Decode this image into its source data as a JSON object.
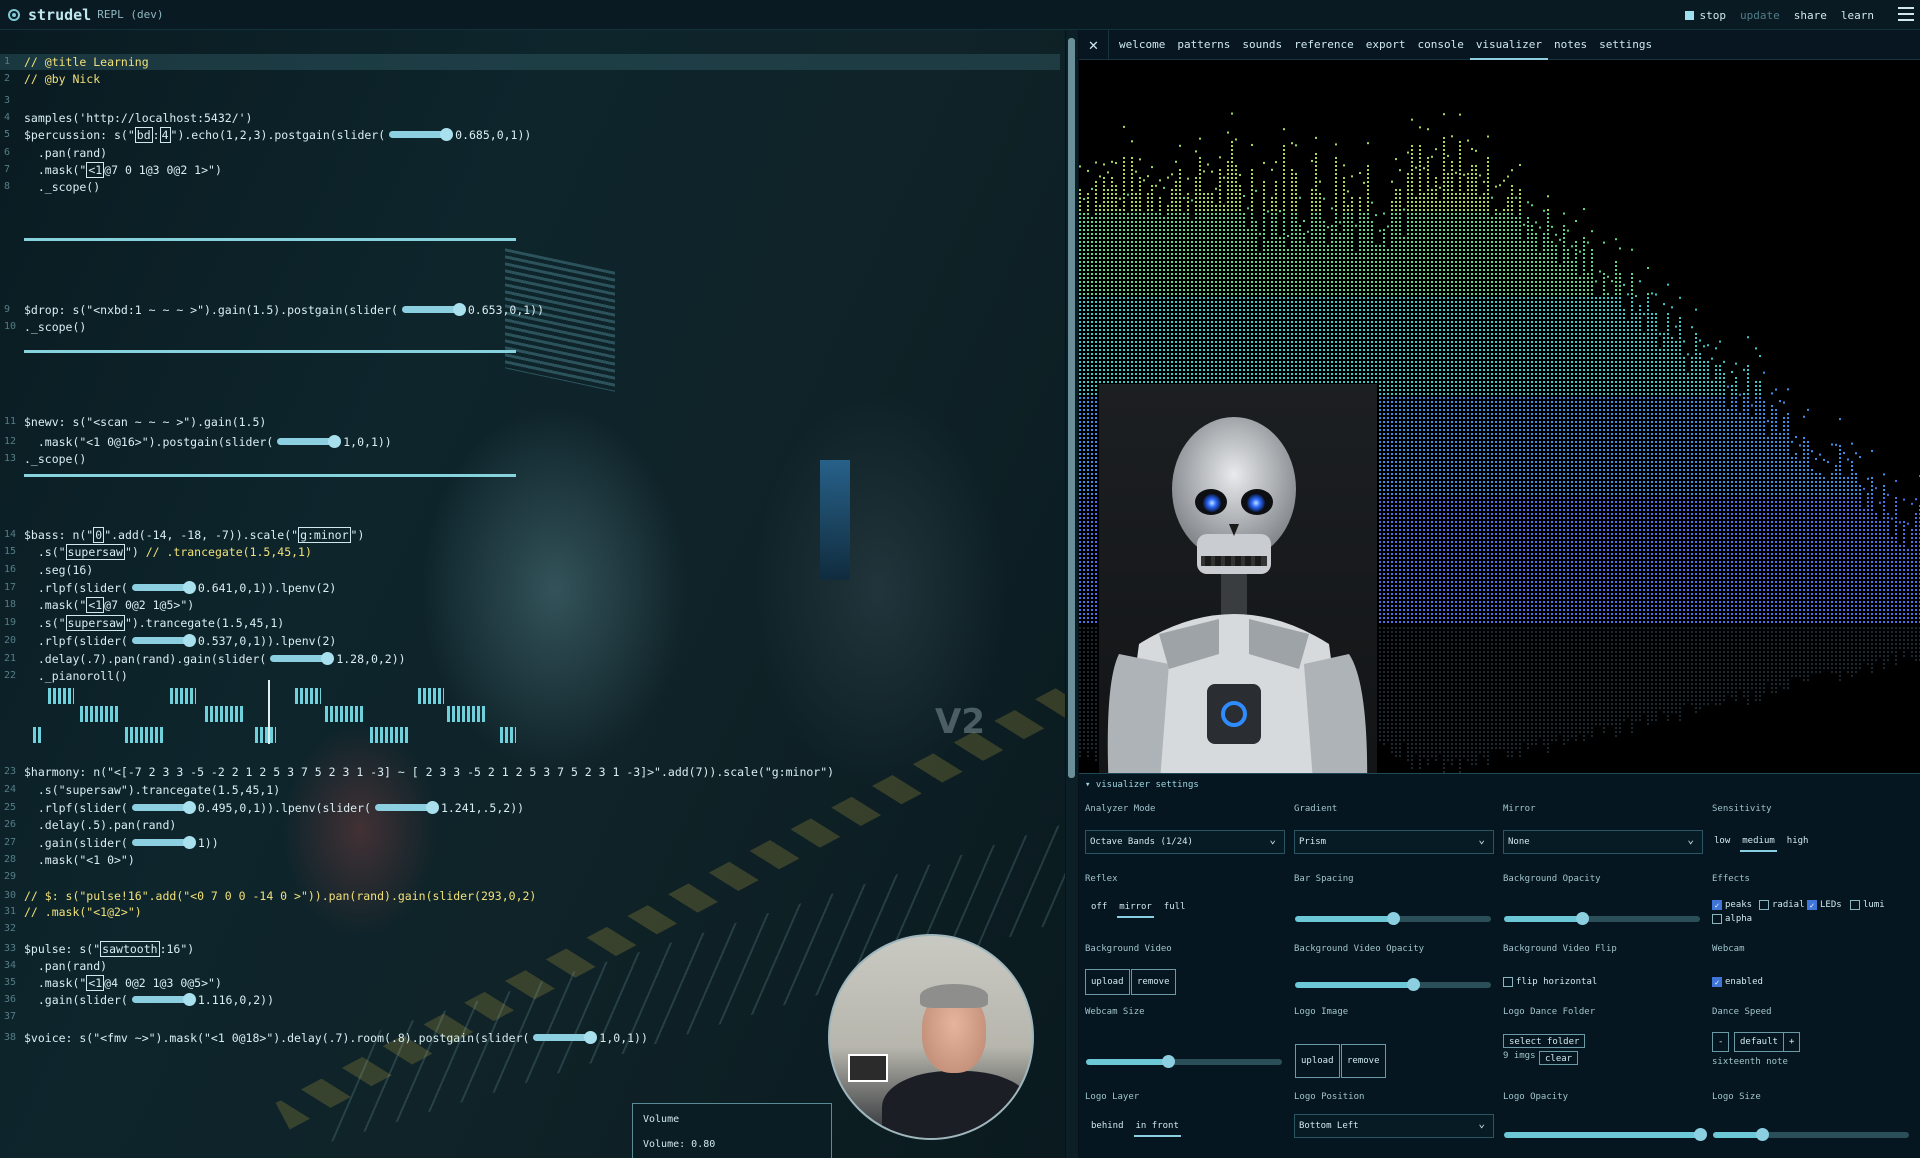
{
  "app": {
    "name": "strudel",
    "sub": "REPL (dev)",
    "actions": {
      "stop": "stop",
      "update": "update",
      "share": "share",
      "learn": "learn"
    }
  },
  "code_lines": [
    {
      "n": "1",
      "html": "<span class=\"c\">// @title Learning</span>",
      "active": true
    },
    {
      "n": "2",
      "html": "<span class=\"c\">// @by Nick</span>"
    },
    {
      "n": "3",
      "html": ""
    },
    {
      "n": "4",
      "html": "samples('http://localhost:5432/')"
    },
    {
      "n": "5",
      "html": "$percussion: s(\"<span class=\"mk\">bd</span>:<span class=\"mk\">4</span>\").echo(1,2,3).postgain(slider(<span class=\"sl\"></span>0.685,0,1))"
    },
    {
      "n": "6",
      "html": "  .pan(rand)"
    },
    {
      "n": "7",
      "html": "  .mask(\"<span class=\"mk\">&lt;1</span>@7 0 1@3 0@2 1&gt;\")"
    },
    {
      "n": "8",
      "html": "  ._scope()"
    },
    {
      "n": "9",
      "html": "$drop: s(\"&lt;nxbd:1 ~ ~ ~ &gt;\").gain(1.5).postgain(slider(<span class=\"sl\"></span>0.653,0,1))"
    },
    {
      "n": "10",
      "html": "._scope()"
    },
    {
      "n": "11",
      "html": "$newv: s(\"&lt;scan ~ ~ ~ &gt;\").gain(1.5)"
    },
    {
      "n": "12",
      "html": "  .mask(\"&lt;1 0@16&gt;\").postgain(slider(<span class=\"sl\"></span>1,0,1))"
    },
    {
      "n": "13",
      "html": "._scope()"
    },
    {
      "n": "14",
      "html": "$bass: n(\"<span class=\"mk\">0</span>\".add(-14, -18, -7)).scale(\"<span class=\"mk\">g:minor</span>\")"
    },
    {
      "n": "15",
      "html": "  .s(\"<span class=\"mk\">supersaw</span>\") <span class=\"c\">// .trancegate(1.5,45,1)</span>"
    },
    {
      "n": "16",
      "html": "  .seg(16)"
    },
    {
      "n": "17",
      "html": "  .rlpf(slider(<span class=\"sl\"></span>0.641,0,1)).lpenv(2)"
    },
    {
      "n": "18",
      "html": "  .mask(\"<span class=\"mk\">&lt;1</span>@7 0@2 1@5&gt;\")"
    },
    {
      "n": "19",
      "html": "  .s(\"<span class=\"mk\">supersaw</span>\").trancegate(1.5,45,1)"
    },
    {
      "n": "20",
      "html": "  .rlpf(slider(<span class=\"sl\"></span>0.537,0,1)).lpenv(2)"
    },
    {
      "n": "21",
      "html": "  .delay(.7).pan(rand).gain(slider(<span class=\"sl\"></span>1.28,0,2))"
    },
    {
      "n": "22",
      "html": "  ._pianoroll()"
    },
    {
      "n": "23",
      "html": "$harmony: n(\"&lt;[-7 2 3 3 -5 -2 2 1 2 5 3 7 5 2 3 1 -3] ~ [ 2 3 3 -5 2 1 2 5 3 7 5 2 3 1 -3]&gt;\".add(7)).scale(\"g:minor\")"
    },
    {
      "n": "24",
      "html": "  .s(\"supersaw\").trancegate(1.5,45,1)"
    },
    {
      "n": "25",
      "html": "  .rlpf(slider(<span class=\"sl\"></span>0.495,0,1)).lpenv(slider(<span class=\"sl\"></span>1.241,.5,2))"
    },
    {
      "n": "26",
      "html": "  .delay(.5).pan(rand)"
    },
    {
      "n": "27",
      "html": "  .gain(slider(<span class=\"sl\"></span>1))"
    },
    {
      "n": "28",
      "html": "  .mask(\"&lt;1 0&gt;\")"
    },
    {
      "n": "29",
      "html": ""
    },
    {
      "n": "30",
      "html": "<span class=\"c\">// $: s(\"pulse!16\".add(\"&lt;0 7 0 0 -14 0 &gt;\")).pan(rand).gain(slider(293,0,2)</span>"
    },
    {
      "n": "31",
      "html": "<span class=\"c\">// .mask(\"&lt;1@2&gt;\")</span>"
    },
    {
      "n": "32",
      "html": ""
    },
    {
      "n": "33",
      "html": "$pulse: s(\"<span class=\"mk\">sawtooth</span>:16\")"
    },
    {
      "n": "34",
      "html": "  .pan(rand)"
    },
    {
      "n": "35",
      "html": "  .mask(\"<span class=\"mk\">&lt;1</span>@4 0@2 1@3 0@5&gt;\")"
    },
    {
      "n": "36",
      "html": "  .gain(slider(<span class=\"sl\"></span>1.116,0,2))"
    },
    {
      "n": "37",
      "html": ""
    },
    {
      "n": "38",
      "html": "$voice: s(\"&lt;fmv ~&gt;\").mask(\"&lt;1 0@18&gt;\").delay(.7).room(.8).postgain(slider(<span class=\"sl\"></span>1,0,1))"
    }
  ],
  "volume": {
    "title": "Volume",
    "text": "Volume: 0.80",
    "value": 0.8
  },
  "tabs": [
    "welcome",
    "patterns",
    "sounds",
    "reference",
    "export",
    "console",
    "visualizer",
    "notes",
    "settings"
  ],
  "active_tab": "visualizer",
  "settings": {
    "header": "▾ visualizer settings",
    "analyzer_mode": {
      "label": "Analyzer Mode",
      "value": "Octave Bands (1/24)"
    },
    "gradient": {
      "label": "Gradient",
      "value": "Prism"
    },
    "mirror": {
      "label": "Mirror",
      "value": "None"
    },
    "sensitivity": {
      "label": "Sensitivity",
      "options": [
        "low",
        "medium",
        "high"
      ],
      "selected": "medium"
    },
    "reflex": {
      "label": "Reflex",
      "options": [
        "off",
        "mirror",
        "full"
      ],
      "selected": "mirror"
    },
    "bar_spacing": {
      "label": "Bar Spacing",
      "value": 0.5
    },
    "background_opacity": {
      "label": "Background Opacity",
      "value": 0.4
    },
    "effects": {
      "label": "Effects",
      "peaks": "peaks",
      "radial": "radial",
      "leds": "LEDs",
      "lumi": "lumi",
      "alpha": "alpha"
    },
    "background_video": {
      "label": "Background Video",
      "upload": "upload",
      "remove": "remove"
    },
    "background_video_opacity": {
      "label": "Background Video Opacity",
      "value": 0.6
    },
    "background_video_flip": {
      "label": "Background Video Flip",
      "checkbox": "flip horizontal"
    },
    "webcam": {
      "label": "Webcam",
      "checkbox": "enabled"
    },
    "webcam_size": {
      "label": "Webcam Size",
      "value": 0.42
    },
    "logo_image": {
      "label": "Logo Image",
      "upload": "upload",
      "remove": "remove"
    },
    "logo_dance_folder": {
      "label": "Logo Dance Folder",
      "select": "select folder",
      "count": "9 imgs",
      "clear": "clear"
    },
    "dance_speed": {
      "label": "Dance Speed",
      "minus": "-",
      "value": "default",
      "plus": "+",
      "note": "sixteenth note"
    },
    "logo_layer": {
      "label": "Logo Layer",
      "options": [
        "behind",
        "in front"
      ],
      "selected": "in front"
    },
    "logo_position": {
      "label": "Logo Position",
      "value": "Bottom Left"
    },
    "logo_opacity": {
      "label": "Logo Opacity",
      "value": 1.0
    },
    "logo_size": {
      "label": "Logo Size",
      "value": 0.25
    }
  }
}
